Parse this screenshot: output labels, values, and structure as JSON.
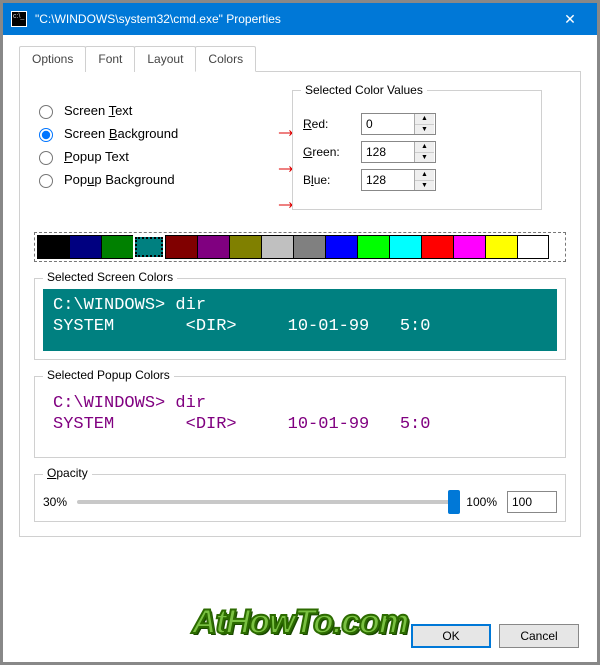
{
  "titlebar": {
    "title": "\"C:\\WINDOWS\\system32\\cmd.exe\" Properties",
    "close_icon": "✕"
  },
  "tabs": [
    {
      "label": "Options",
      "active": false
    },
    {
      "label": "Font",
      "active": false
    },
    {
      "label": "Layout",
      "active": false
    },
    {
      "label": "Colors",
      "active": true
    }
  ],
  "radios": {
    "screen_text": {
      "label_pre": "Screen ",
      "u": "T",
      "label_post": "ext",
      "checked": false
    },
    "screen_background": {
      "label_pre": "Screen ",
      "u": "B",
      "label_post": "ackground",
      "checked": true
    },
    "popup_text": {
      "label_pre": "",
      "u": "P",
      "label_post": "opup Text",
      "checked": false
    },
    "popup_background": {
      "label_pre": "Pop",
      "u": "u",
      "label_post": "p Background",
      "checked": false
    }
  },
  "color_values": {
    "legend": "Selected Color Values",
    "red": {
      "u": "R",
      "label": "ed:",
      "value": "0"
    },
    "green": {
      "u": "G",
      "label": "reen:",
      "value": "128"
    },
    "blue": {
      "u": "B",
      "label_pre": "",
      "u2": "l",
      "label": "ue:",
      "value": "128"
    }
  },
  "palette": [
    "#000000",
    "#000080",
    "#008000",
    "#008080",
    "#800000",
    "#800080",
    "#808000",
    "#c0c0c0",
    "#808080",
    "#0000ff",
    "#00ff00",
    "#00ffff",
    "#ff0000",
    "#ff00ff",
    "#ffff00",
    "#ffffff"
  ],
  "palette_selected_index": 3,
  "screen_preview": {
    "legend": "Selected Screen Colors",
    "line1": "C:\\WINDOWS> dir",
    "line2": "SYSTEM       <DIR>     10-01-99   5:0"
  },
  "popup_preview": {
    "legend": "Selected Popup Colors",
    "line1": "C:\\WINDOWS> dir",
    "line2": "SYSTEM       <DIR>     10-01-99   5:0"
  },
  "opacity": {
    "legend_u": "O",
    "legend": "pacity",
    "min_label": "30%",
    "max_label": "100%",
    "value": "100",
    "thumb_percent": 100
  },
  "buttons": {
    "ok": "OK",
    "cancel": "Cancel"
  },
  "watermark": "AtHowTo.com"
}
